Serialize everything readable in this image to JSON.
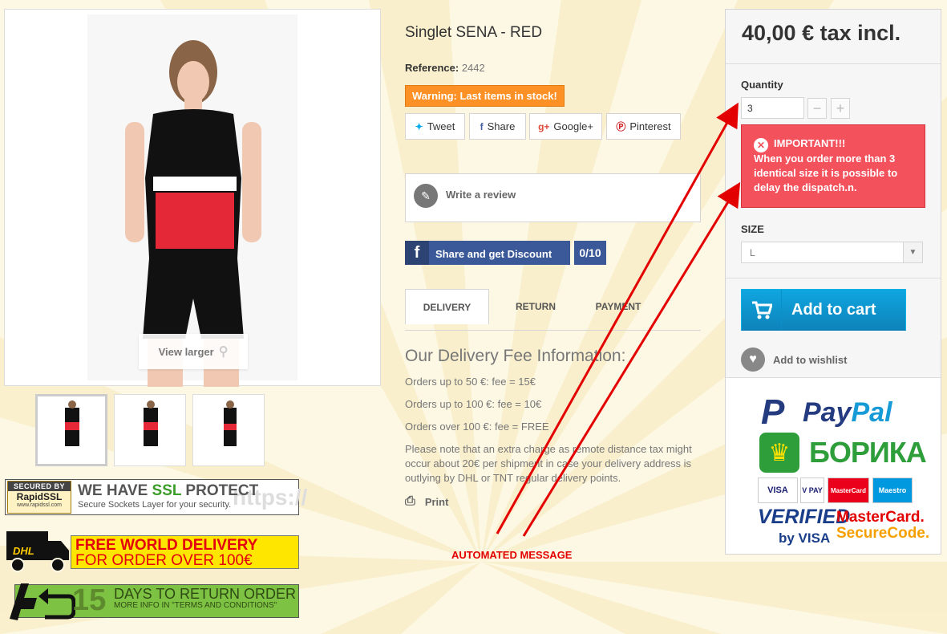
{
  "product": {
    "title": "Singlet SENA - RED",
    "reference_label": "Reference:",
    "reference_value": "2442",
    "stock_warning": "Warning: Last items in stock!",
    "view_larger": "View larger"
  },
  "social": {
    "tweet": "Tweet",
    "share": "Share",
    "googleplus": "Google+",
    "pinterest": "Pinterest"
  },
  "review": {
    "label": "Write a review"
  },
  "facebook": {
    "label": "Share and get Discount",
    "count": "0/10"
  },
  "tabs": [
    {
      "label": "DELIVERY"
    },
    {
      "label": "RETURN"
    },
    {
      "label": "PAYMENT"
    }
  ],
  "delivery": {
    "heading": "Our Delivery Fee Information:",
    "lines": [
      "Orders up to 50 €: fee = 15€",
      "Orders up to 100 €: fee = 10€",
      "Orders over 100 €: fee = FREE"
    ],
    "note": "Please note that an extra charge as remote distance tax might occur about 20€ per shipment in case your delivery address is outlying by DHL or TNT regular delivery points.",
    "print": "Print"
  },
  "annotation": {
    "label": "AUTOMATED MESSAGE",
    "color": "#e30000"
  },
  "buybox": {
    "price": "40,00 € tax incl.",
    "quantity_label": "Quantity",
    "quantity_value": "3",
    "minus": "−",
    "plus": "+",
    "important_title": "IMPORTANT!!!",
    "important_text": "When you order more than 3 identical size it is possible to delay the dispatch.n.",
    "size_label": "SIZE",
    "size_value": "L",
    "add_to_cart": "Add to cart",
    "add_to_wishlist": "Add to wishlist"
  },
  "payments": {
    "paypal_a": "Pay",
    "paypal_b": "Pal",
    "borica": "БОРИКА",
    "cards": [
      "VISA",
      "V PAY",
      "MasterCard",
      "Maestro"
    ],
    "verified": "VERIFIED",
    "byvisa": "by VISA",
    "mc_a": "MasterCard.",
    "mc_b": "SecureCode."
  },
  "badges": {
    "ssl_seal_top": "SECURED BY",
    "ssl_seal_mid": "RapidSSL",
    "ssl_seal_bot": "www.rapidssl.com",
    "ssl_title_a": "WE HAVE ",
    "ssl_title_b": "SSL",
    "ssl_title_c": " PROTECT",
    "ssl_sub": "Secure Sockets Layer for your security.",
    "ssl_https": "https://",
    "dhl_line1": "FREE WORLD DELIVERY",
    "dhl_line2": "FOR ORDER OVER 100€",
    "dhl_logo": "DHL",
    "ret_num": "15",
    "ret_line1": "DAYS TO RETURN ORDER",
    "ret_line2": "MORE INFO IN \"TERMS AND CONDITIONS\""
  },
  "colors": {
    "accent_blue": "#0e8fd0",
    "warning_orange": "#fe9126",
    "important_red": "#f3515c",
    "facebook_blue": "#3b5998"
  }
}
